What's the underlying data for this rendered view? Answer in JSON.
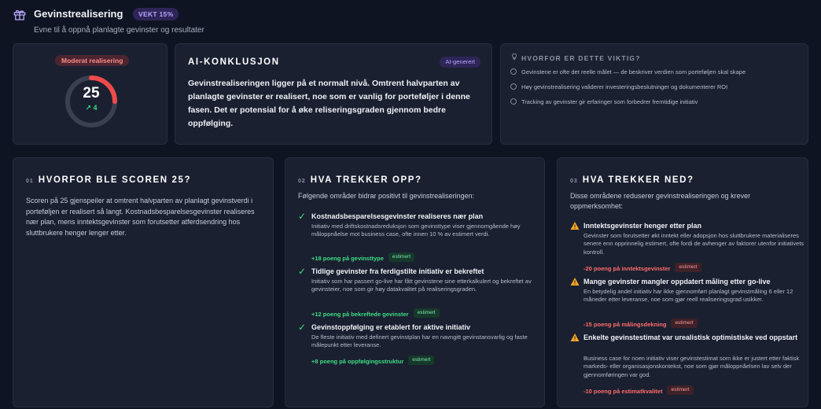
{
  "header": {
    "title": "Gevinstrealisering",
    "weight_badge": "VEKT 15%",
    "subtitle": "Evne til å oppnå planlagte gevinster og resultater"
  },
  "score": {
    "badge": "Moderat realisering",
    "value": "25",
    "delta": "↗ 4",
    "gauge_fraction": 0.25
  },
  "ai": {
    "title": "AI-KONKLUSJON",
    "badge": "AI-generert",
    "text": "Gevinstrealiseringen ligger på et normalt nivå. Omtrent halvparten av planlagte gevinster er realisert, noe som er vanlig for porteføljer i denne fasen. Det er potensial for å øke reliseringsgraden gjennom bedre oppfølging."
  },
  "why": {
    "title": "HVORFOR ER DETTE VIKTIG?",
    "items": [
      "Gevinstene er ofte det reelle målet — de beskriver verdien som porteføljen skal skape",
      "Høy gevinstrealisering validerer investeringsbeslutninger og dokumenterer ROI",
      "Tracking av gevinster gir erfaringer som forbedrer fremtidige initiativ"
    ]
  },
  "why_score": {
    "num": "01",
    "title": "HVORFOR BLE SCOREN 25?",
    "body": "Scoren på 25 gjenspeiler at omtrent halvparten av planlagt gevinstverdi i porteføljen er realisert så langt. Kostnadsbesparelsesgevinster realiseres nær plan, mens inntektsgevinster som forutsetter atferdsendring hos sluttbrukere henger lenger etter."
  },
  "up": {
    "num": "02",
    "title": "HVA TREKKER OPP?",
    "intro": "Følgende områder bidrar positivt til gevinstrealiseringen:",
    "items": [
      {
        "title": "Kostnadsbesparelsesgevinster realiseres nær plan",
        "desc": "Initiativ med driftskostnadsreduksjon som gevinsttype viser gjennomgående høy måloppnåelse mot business case, ofte innen 10 % av estimert verdi.",
        "points": "+18 poeng på gevinsttype",
        "tag": "estimert"
      },
      {
        "title": "Tidlige gevinster fra ferdigstilte initiativ er bekreftet",
        "desc": "Initiativ som har passert go-live har fått gevinstene sine etterkalkulert og bekreftet av gevinsteier, noe som gir høy datakvalitet på realiseringsgraden.",
        "points": "+12 poeng på bekreftede gevinster",
        "tag": "estimert"
      },
      {
        "title": "Gevinstoppfølging er etablert for aktive initiativ",
        "desc": "De fleste initiativ med definert gevinstplan har en navngitt gevinstansvarlig og faste målepunkt etter leveranse.",
        "points": "+8 poeng på oppfølgingsstruktur",
        "tag": "estimert"
      }
    ]
  },
  "down": {
    "num": "03",
    "title": "HVA TREKKER NED?",
    "intro": "Disse områdene reduserer gevinstrealiseringen og krever oppmerksomhet:",
    "items": [
      {
        "title": "Inntektsgevinster henger etter plan",
        "desc": "Gevinster som forutsetter økt inntekt eller adopsjon hos sluttbrukere materialiseres senere enn opprinnelig estimert, ofte fordi de avhenger av faktorer utenfor initiativets kontroll.",
        "points": "-20 poeng på inntektsgevinster",
        "tag": "estimert"
      },
      {
        "title": "Mange gevinster mangler oppdatert måling etter go-live",
        "desc": "En betydelig andel initiativ har ikke gjennomført planlagt gevinstmåling 6 eller 12 måneder etter leveranse, noe som gjør reell realiseringsgrad usikker.",
        "points": "-15 poeng på målingsdekning",
        "tag": "estimert"
      },
      {
        "title": "Enkelte gevinstestimat var urealistisk optimistiske ved oppstart",
        "desc": "Business case for noen initiativ viser gevinstestimat som ikke er justert etter faktisk markeds- eller organisasjonskontekst, noe som gjør måloppnåelsen lav selv der gjennomføringen var god.",
        "points": "-10 poeng på estimatkvalitet",
        "tag": "estimert"
      }
    ]
  },
  "colors": {
    "background": "#0f1422",
    "card": "#1a2030",
    "positive": "#3ddc84",
    "negative": "#ff6b6b",
    "warning": "#f5a623",
    "accent": "#b9a6ff",
    "gauge_track": "#394052"
  },
  "icons": {
    "header": "gift-icon",
    "why": "lightbulb-icon",
    "why_items": "check-circle-icon",
    "up_items": "checkmark-icon",
    "down_items": "warning-triangle-icon"
  }
}
